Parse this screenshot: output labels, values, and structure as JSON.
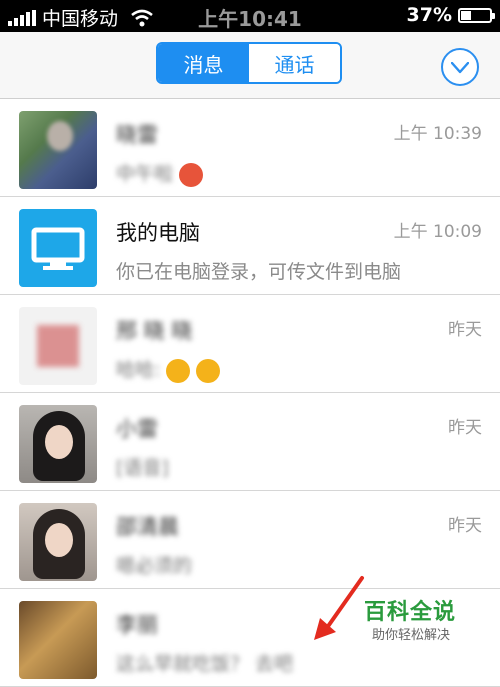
{
  "status_bar": {
    "carrier": "中国移动",
    "time": "上午10:41",
    "battery": "37%",
    "battery_level": 0.37
  },
  "nav": {
    "tabs": [
      {
        "label": "消息",
        "active": true
      },
      {
        "label": "通话",
        "active": false
      }
    ],
    "menu_icon": "chevron-down-circle-icon",
    "accent_color": "#1e8ef1"
  },
  "conversations": [
    {
      "name": "晓雷",
      "preview": "中午啦",
      "time": "上午 10:39",
      "blurred": true,
      "avatar": "photo"
    },
    {
      "name": "我的电脑",
      "preview": "你已在电脑登录，可传文件到电脑",
      "time": "上午 10:09",
      "blurred": false,
      "avatar": "computer-icon"
    },
    {
      "name": "邢 晓 晓",
      "preview": "哈哈:",
      "time": "昨天",
      "blurred": true,
      "avatar": "stamp"
    },
    {
      "name": "小雷",
      "preview": "[语音]",
      "time": "昨天",
      "blurred": true,
      "avatar": "photo"
    },
    {
      "name": "邵清晨",
      "preview": "嗯必须的",
      "time": "昨天",
      "blurred": true,
      "avatar": "photo"
    },
    {
      "name": "李丽",
      "preview": "这么早就吃饭？ 去吧",
      "time": "",
      "blurred": true,
      "avatar": "photo"
    }
  ],
  "watermark": {
    "title": "百科全说",
    "subtitle": "助你轻松解决"
  }
}
